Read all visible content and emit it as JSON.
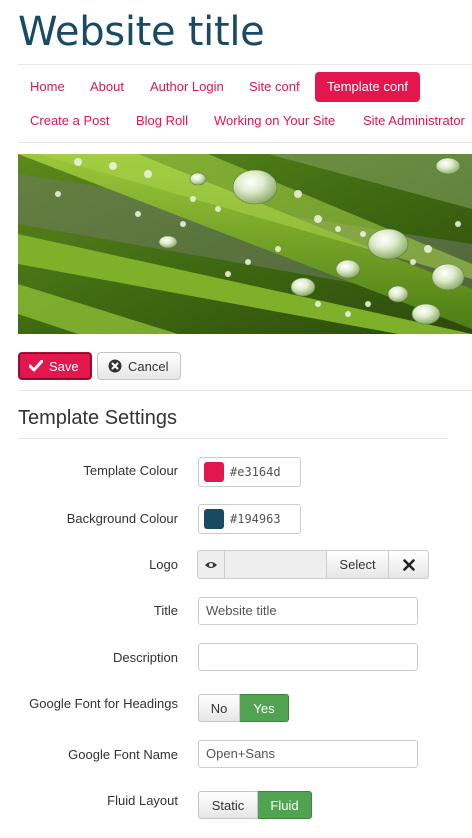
{
  "site": {
    "title": "Website title"
  },
  "nav": {
    "items": [
      {
        "label": "Home"
      },
      {
        "label": "About"
      },
      {
        "label": "Author Login"
      },
      {
        "label": "Site conf"
      },
      {
        "label": "Template conf",
        "active": true
      },
      {
        "label": "Create a Post"
      },
      {
        "label": "Blog Roll"
      },
      {
        "label": "Working on Your Site"
      },
      {
        "label": "Site Administrator"
      }
    ]
  },
  "banner": {
    "icon": "water-drops-on-grass-image"
  },
  "toolbar": {
    "save_label": "Save",
    "save_icon": "check-icon",
    "cancel_label": "Cancel",
    "cancel_icon": "x-circle-icon"
  },
  "form": {
    "section_title": "Template Settings",
    "template_colour": {
      "label": "Template Colour",
      "value": "#e3164d",
      "swatch": "#e3164d"
    },
    "background_colour": {
      "label": "Background Colour",
      "value": "#194963",
      "swatch": "#194963"
    },
    "logo": {
      "label": "Logo",
      "select_label": "Select",
      "preview_icon": "eye-icon",
      "clear_icon": "close-icon"
    },
    "title": {
      "label": "Title",
      "value": "Website title"
    },
    "description": {
      "label": "Description",
      "value": ""
    },
    "google_font_headings": {
      "label": "Google Font for Headings",
      "options": [
        "No",
        "Yes"
      ],
      "selected": "Yes"
    },
    "google_font_name": {
      "label": "Google Font Name",
      "value": "Open+Sans"
    },
    "fluid_layout": {
      "label": "Fluid Layout",
      "options": [
        "Static",
        "Fluid"
      ],
      "selected": "Fluid"
    }
  },
  "colors": {
    "accent": "#e3164d",
    "title": "#194963",
    "success": "#51a351"
  }
}
